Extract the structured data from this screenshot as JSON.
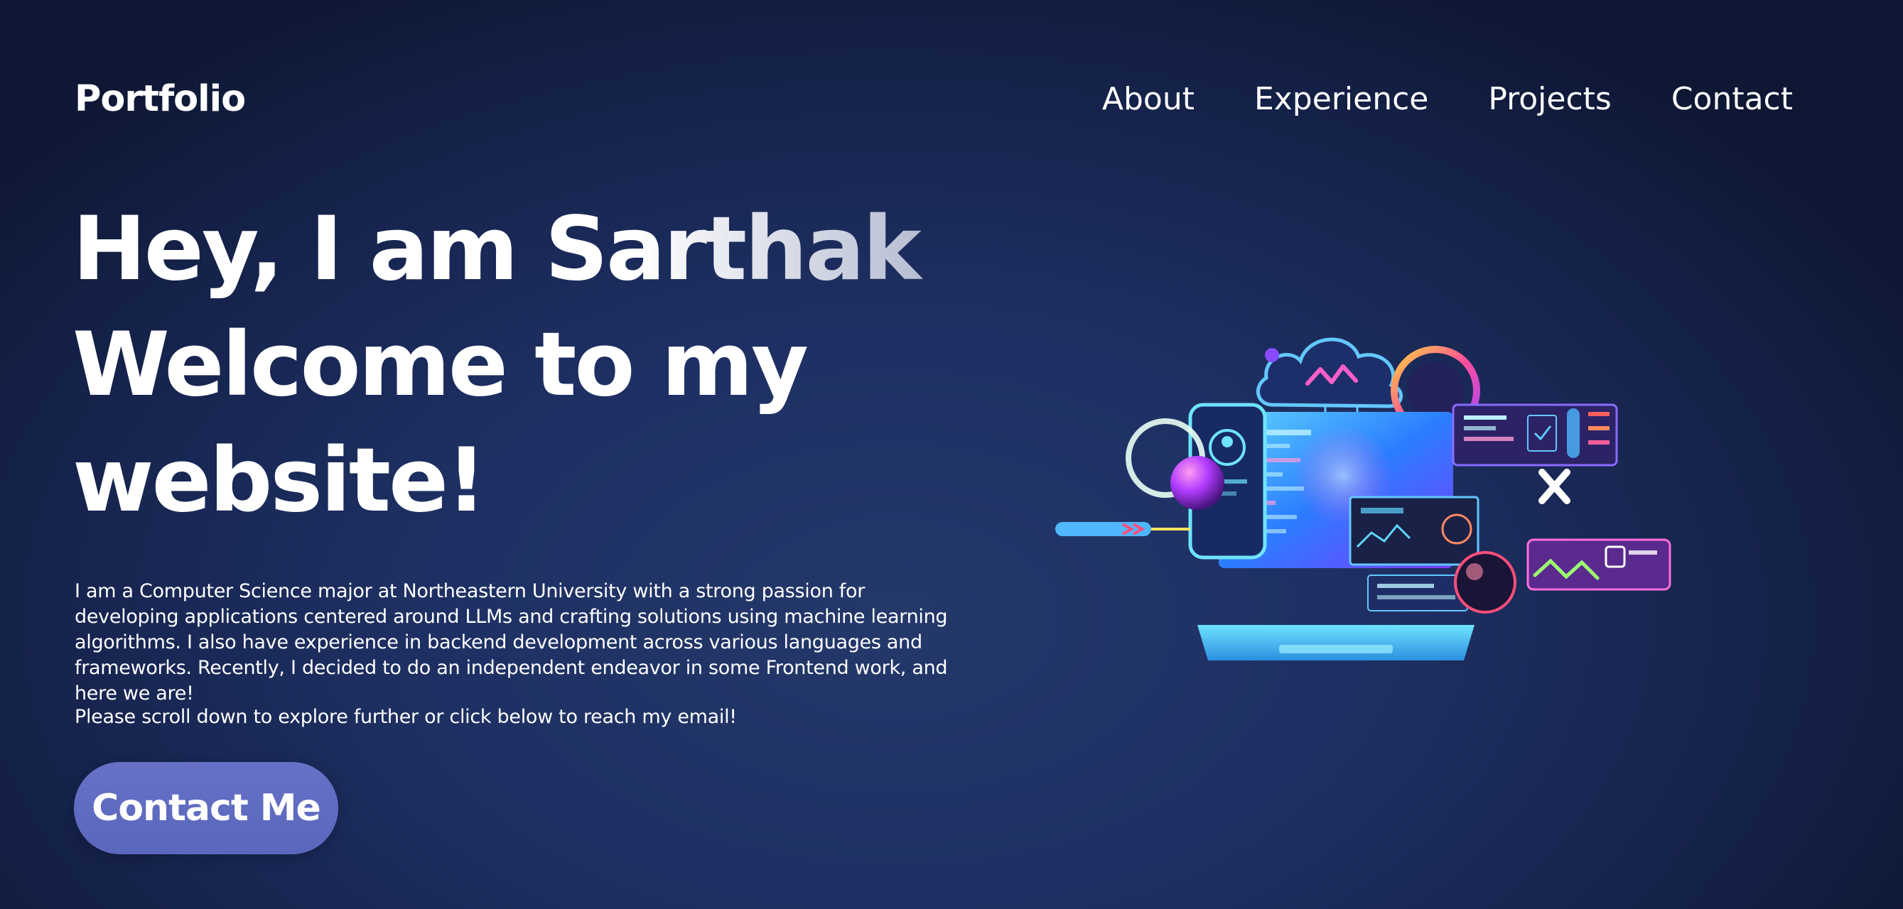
{
  "nav": {
    "brand": "Portfolio",
    "links": [
      "About",
      "Experience",
      "Projects",
      "Contact"
    ]
  },
  "hero": {
    "title_line1": "Hey, I am Sarthak.",
    "title_line2": "Welcome to my",
    "title_line3": "website!",
    "intro": "I am a Computer Science major at Northeastern University with a strong passion for developing applications centered around LLMs and crafting solutions using machine learning algorithms. I also have experience in backend development across various languages and frameworks. Recently, I decided to do an independent endeavor in some Frontend work, and here we are!",
    "cta_text": "Please scroll down to explore further or click below to reach my email!",
    "button_label": "Contact Me"
  },
  "illustration": {
    "icon": "tech-laptop-cloud-illustration",
    "colors": {
      "cyan": "#3fd0ff",
      "magenta": "#ff3fa8",
      "purple": "#8a4bff",
      "screen_blue": "#2b7dff"
    }
  },
  "colors": {
    "background_dark": "#0e1733",
    "background_mid": "#1e3063",
    "button": "#6671c6",
    "text": "#ffffff"
  }
}
